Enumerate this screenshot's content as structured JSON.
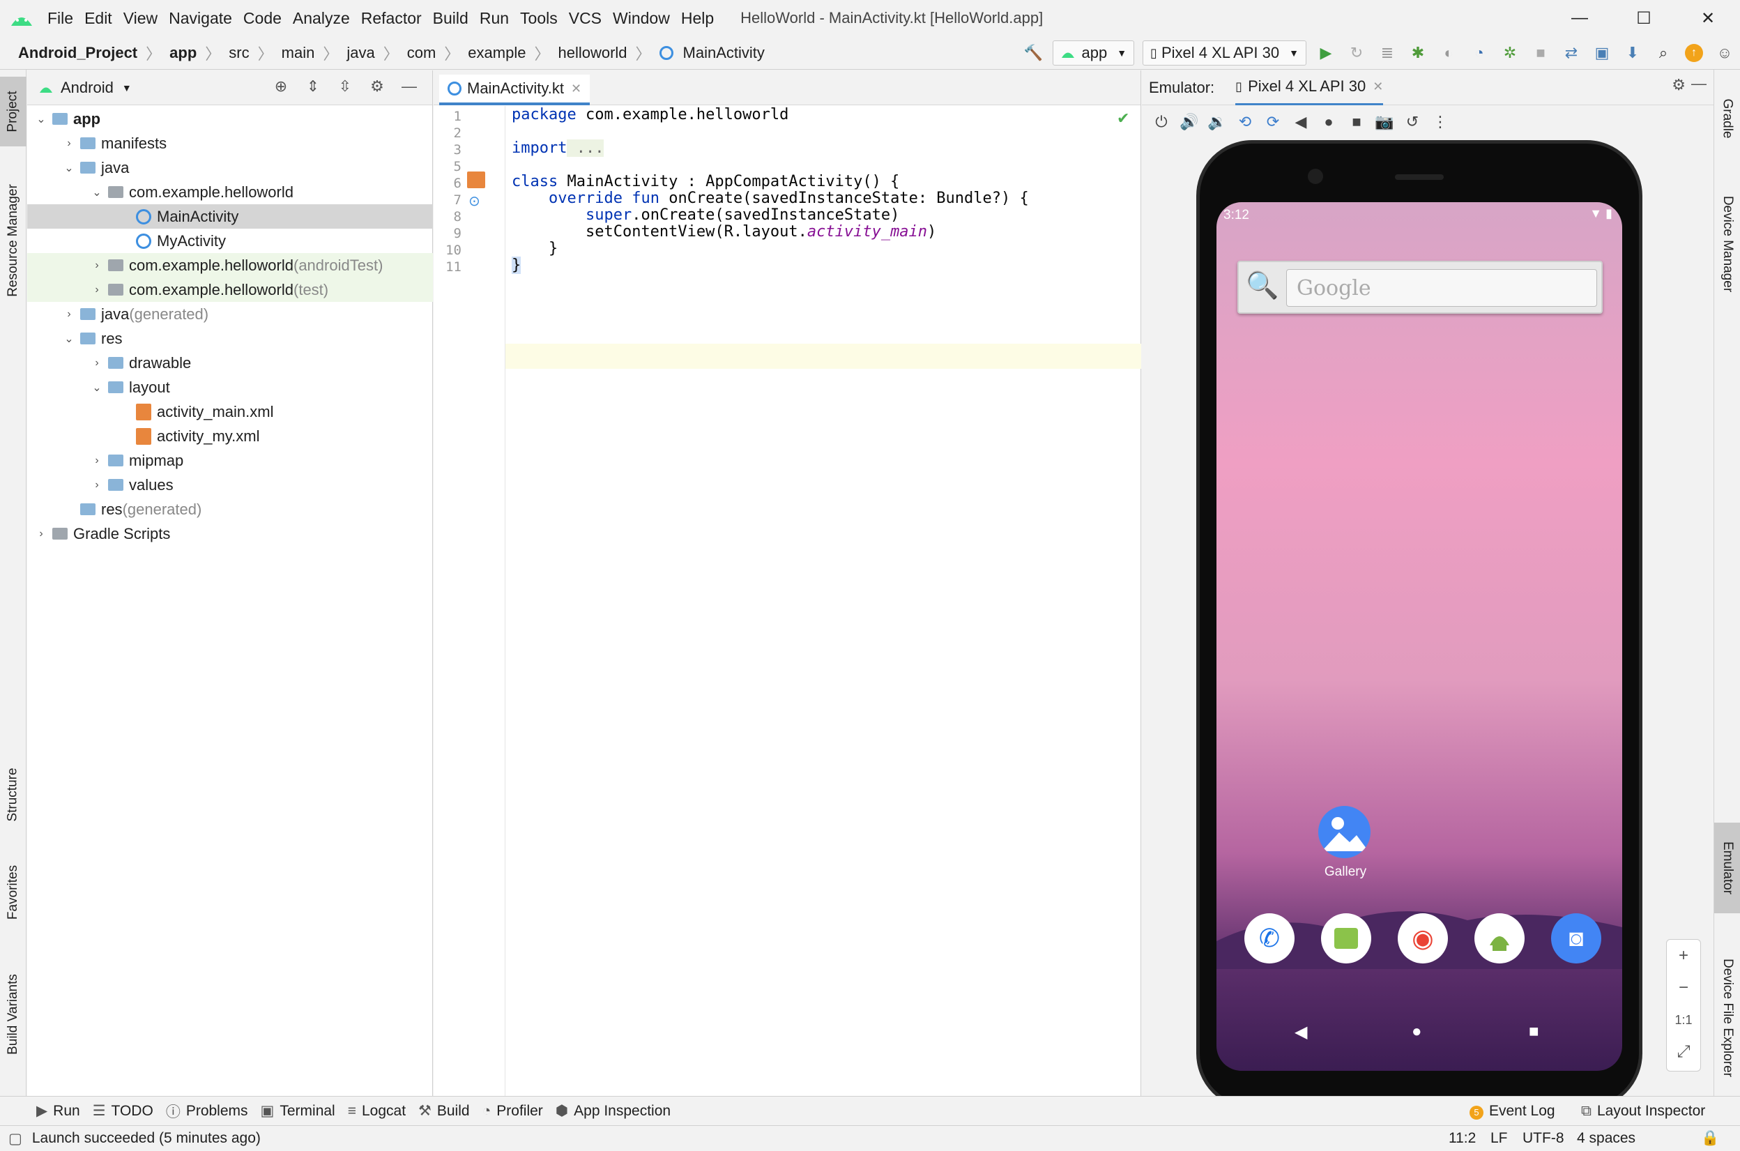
{
  "window": {
    "title": "HelloWorld - MainActivity.kt [HelloWorld.app]",
    "menus": [
      "File",
      "Edit",
      "View",
      "Navigate",
      "Code",
      "Analyze",
      "Refactor",
      "Build",
      "Run",
      "Tools",
      "VCS",
      "Window",
      "Help"
    ],
    "controls": [
      "—",
      "☐",
      "✕"
    ]
  },
  "breadcrumb": [
    "Android_Project",
    "app",
    "src",
    "main",
    "java",
    "com",
    "example",
    "helloworld",
    "MainActivity"
  ],
  "toolbar": {
    "run_config": "app",
    "device": "Pixel 4 XL API 30"
  },
  "left_tabs": [
    "Project",
    "Resource Manager",
    "Structure",
    "Favorites",
    "Build Variants"
  ],
  "right_tabs": [
    "Gradle",
    "Device Manager",
    "Emulator",
    "Device File Explorer"
  ],
  "project": {
    "view": "Android",
    "tree": [
      {
        "label": "app",
        "suffix": "",
        "icon": "folder",
        "bold": true
      },
      {
        "label": "manifests",
        "suffix": "",
        "icon": "folder"
      },
      {
        "label": "java",
        "suffix": "",
        "icon": "folder"
      },
      {
        "label": "com.example.helloworld",
        "suffix": "",
        "icon": "package"
      },
      {
        "label": "MainActivity",
        "suffix": "",
        "icon": "kotlin"
      },
      {
        "label": "MyActivity",
        "suffix": "",
        "icon": "kotlin"
      },
      {
        "label": "com.example.helloworld",
        "suffix": " (androidTest)",
        "icon": "package"
      },
      {
        "label": "com.example.helloworld",
        "suffix": " (test)",
        "icon": "package"
      },
      {
        "label": "java",
        "suffix": " (generated)",
        "icon": "folder"
      },
      {
        "label": "res",
        "suffix": "",
        "icon": "folder"
      },
      {
        "label": "drawable",
        "suffix": "",
        "icon": "folder"
      },
      {
        "label": "layout",
        "suffix": "",
        "icon": "folder"
      },
      {
        "label": "activity_main.xml",
        "suffix": "",
        "icon": "xml"
      },
      {
        "label": "activity_my.xml",
        "suffix": "",
        "icon": "xml"
      },
      {
        "label": "mipmap",
        "suffix": "",
        "icon": "folder"
      },
      {
        "label": "values",
        "suffix": "",
        "icon": "folder"
      },
      {
        "label": "res",
        "suffix": " (generated)",
        "icon": "folder"
      },
      {
        "label": "Gradle Scripts",
        "suffix": "",
        "icon": "gradle"
      }
    ]
  },
  "editor": {
    "tab": "MainActivity.kt",
    "line_numbers": [
      "1",
      "2",
      "3",
      "5",
      "6",
      "7",
      "8",
      "9",
      "10",
      "11"
    ],
    "code": {
      "l1_kw": "package",
      "l1": " com.example.helloworld",
      "l3_kw": "import",
      "l3": " ...",
      "l6_kw": "class",
      "l6": " MainActivity : AppCompatActivity() {",
      "l7_kw1": "override",
      "l7_kw2": "fun",
      "l7": " onCreate(savedInstanceState: Bundle?) {",
      "l8_kw": "super",
      "l8": ".onCreate(savedInstanceState)",
      "l9": "setContentView(R.layout.",
      "l9_it": "activity_main",
      "l9_end": ")",
      "l10": "}",
      "l11": "}"
    }
  },
  "emulator": {
    "label": "Emulator:",
    "device_tab": "Pixel 4 XL API 30",
    "status_time": "3:12",
    "search_placeholder": "Google",
    "gallery_label": "Gallery",
    "zoom": [
      "+",
      "−",
      "1:1",
      "⤢"
    ]
  },
  "bottom_tools": [
    "Run",
    "TODO",
    "Problems",
    "Terminal",
    "Logcat",
    "Build",
    "Profiler",
    "App Inspection"
  ],
  "right_bottom_tools": [
    "Event Log",
    "Layout Inspector"
  ],
  "status": {
    "message": "Launch succeeded (5 minutes ago)",
    "position": "11:2",
    "line_sep": "LF",
    "encoding": "UTF-8",
    "indent": "4 spaces"
  }
}
